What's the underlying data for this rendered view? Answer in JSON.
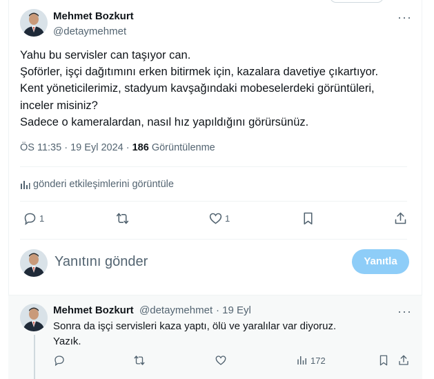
{
  "tweet": {
    "author_name": "Mehmet Bozkurt",
    "author_handle": "@detaymehmet",
    "more_label": "···",
    "lines": [
      "Yahu bu servisler can taşıyor can.",
      "Şoförler, işçi dağıtımını erken bitirmek için, kazalara davetiye çıkartıyor.",
      "Kent yöneticilerimiz, stadyum kavşağındaki mobeselerdeki görüntüleri,",
      "inceler misiniz?",
      "Sadece o kameralardan, nasıl hız yapıldığını görürsünüz."
    ],
    "time": "ÖS 11:35",
    "dot": "·",
    "date": "19 Eyl 2024",
    "views_count": "186",
    "views_label": "Görüntülenme",
    "engagements_label": "gönderi etkileşimlerini görüntüle",
    "reply_count": "1",
    "like_count": "1"
  },
  "compose": {
    "placeholder": "Yanıtını gönder",
    "reply_button": "Yanıtla"
  },
  "reply": {
    "author_name": "Mehmet Bozkurt",
    "author_handle": "@detaymehmet",
    "date": "· 19 Eyl",
    "more_label": "···",
    "lines": [
      "Sonra da işçi servisleri kaza yaptı, ölü ve yaralılar var diyoruz.",
      "Yazık."
    ],
    "views_count": "172"
  },
  "colors": {
    "accent_disabled": "#8ecdf8",
    "secondary_text": "#536471",
    "primary_text": "#0f1419"
  }
}
